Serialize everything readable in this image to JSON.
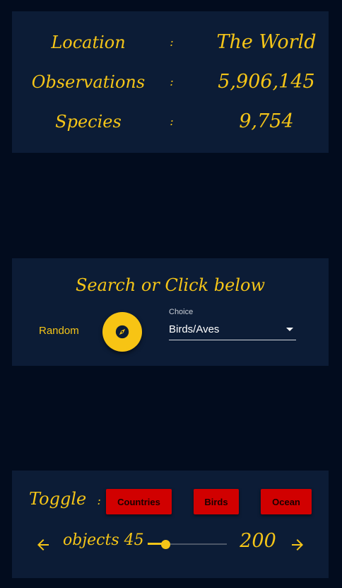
{
  "stats": {
    "rows": [
      {
        "label": "Location",
        "separator": ":",
        "value": "The World"
      },
      {
        "label": "Observations",
        "separator": ":",
        "value": "5,906,145"
      },
      {
        "label": "Species",
        "separator": ":",
        "value": "9,754"
      }
    ]
  },
  "search": {
    "title": "Search or Click below",
    "random_label": "Random",
    "random_icon": "compass-icon",
    "choice": {
      "label": "Choice",
      "value": "Birds/Aves"
    }
  },
  "toggle": {
    "label": "Toggle",
    "separator": ":",
    "buttons": [
      "Countries",
      "Birds",
      "Ocean"
    ],
    "objects_label": "objects 45",
    "slider": {
      "min": 0,
      "max": 200,
      "value": 45,
      "fraction": 0.225
    },
    "max_value": "200"
  },
  "colors": {
    "background": "#020c1e",
    "card": "#0c1c36",
    "accent": "#f5c518",
    "toggle_button": "#d10000"
  }
}
